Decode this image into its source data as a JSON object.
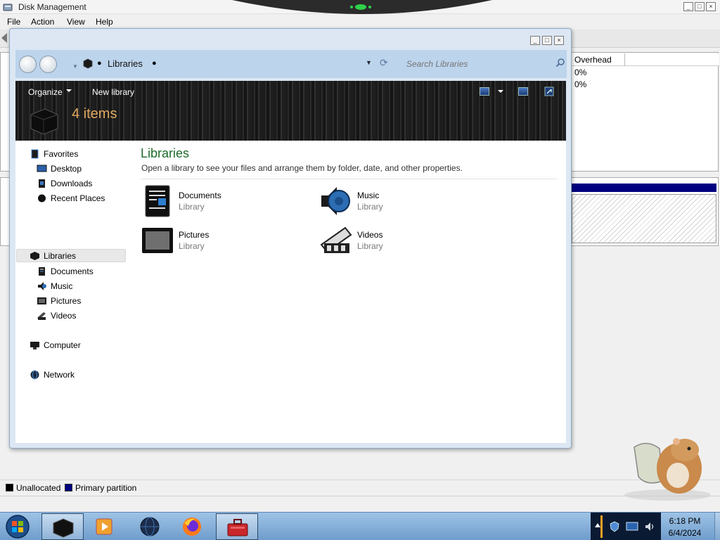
{
  "disk_management": {
    "title": "Disk Management",
    "menu": [
      "File",
      "Action",
      "View",
      "Help"
    ],
    "column_header": "Overhead",
    "overhead_values": [
      "0%",
      "0%"
    ],
    "legend": [
      {
        "label": "Unallocated",
        "color": "#000000"
      },
      {
        "label": "Primary partition",
        "color": "#000080"
      }
    ]
  },
  "explorer": {
    "breadcrumb": "Libraries",
    "search_placeholder": "Search Libraries",
    "toolbar": {
      "organize": "Organize",
      "new_library": "New library"
    },
    "item_count": "4 items",
    "nav": {
      "favorites": "Favorites",
      "favorites_items": [
        "Desktop",
        "Downloads",
        "Recent Places"
      ],
      "libraries": "Libraries",
      "libraries_items": [
        "Documents",
        "Music",
        "Pictures",
        "Videos"
      ],
      "computer": "Computer",
      "network": "Network"
    },
    "content": {
      "title": "Libraries",
      "subtitle": "Open a library to see your files and arrange them by folder, date, and other properties.",
      "libraries": [
        {
          "name": "Documents",
          "type": "Library",
          "icon": "documents-library-icon"
        },
        {
          "name": "Music",
          "type": "Library",
          "icon": "music-library-icon"
        },
        {
          "name": "Pictures",
          "type": "Library",
          "icon": "pictures-library-icon"
        },
        {
          "name": "Videos",
          "type": "Library",
          "icon": "videos-library-icon"
        }
      ]
    }
  },
  "taskbar": {
    "pinned": [
      "explorer-icon",
      "media-player-icon",
      "globe-browser-icon",
      "firefox-icon",
      "toolbox-icon"
    ],
    "active": "explorer-icon",
    "clock": {
      "time": "6:18 PM",
      "date": "6/4/2024"
    }
  },
  "colors": {
    "explorer_accent": "#e3a862",
    "content_title": "#1e6b2b",
    "partition_primary": "#000080",
    "taskbar": "#8fb3d8"
  }
}
